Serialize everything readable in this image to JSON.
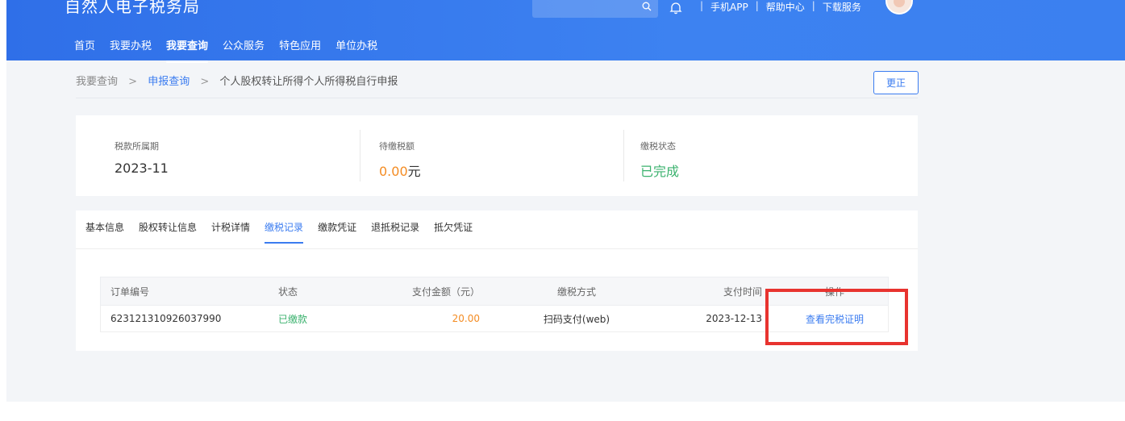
{
  "header": {
    "site_title": "自然人电子税务局",
    "links": [
      "手机APP",
      "帮助中心",
      "下载服务"
    ],
    "nav": [
      "首页",
      "我要办税",
      "我要查询",
      "公众服务",
      "特色应用",
      "单位办税"
    ],
    "active_nav_index": 2
  },
  "breadcrumb": {
    "root": "我要查询",
    "parent": "申报查询",
    "current": "个人股权转让所得个人所得税自行申报",
    "separator": ">"
  },
  "actions": {
    "correct_label": "更正"
  },
  "summary": {
    "period_label": "税款所属期",
    "period_value": "2023-11",
    "pending_label": "待缴税额",
    "pending_amount": "0.00",
    "pending_unit": "元",
    "status_label": "缴税状态",
    "status_value": "已完成"
  },
  "tabs": {
    "items": [
      "基本信息",
      "股权转让信息",
      "计税详情",
      "缴税记录",
      "缴款凭证",
      "退抵税记录",
      "抵欠凭证"
    ],
    "active_index": 3
  },
  "table": {
    "columns": {
      "order_no": "订单编号",
      "status": "状态",
      "amount": "支付金额（元）",
      "method": "缴税方式",
      "time": "支付时间",
      "operation": "操作"
    },
    "rows": [
      {
        "order_no": "623121310926037990",
        "status": "已缴款",
        "amount": "20.00",
        "method": "扫码支付(web)",
        "time": "2023-12-13",
        "operation": "查看完税证明"
      }
    ]
  },
  "colors": {
    "primary": "#3b7cf0",
    "header_blue": "#2f6fe8",
    "orange": "#f48c23",
    "green": "#3bb26e",
    "highlight_red": "#e8332f"
  }
}
